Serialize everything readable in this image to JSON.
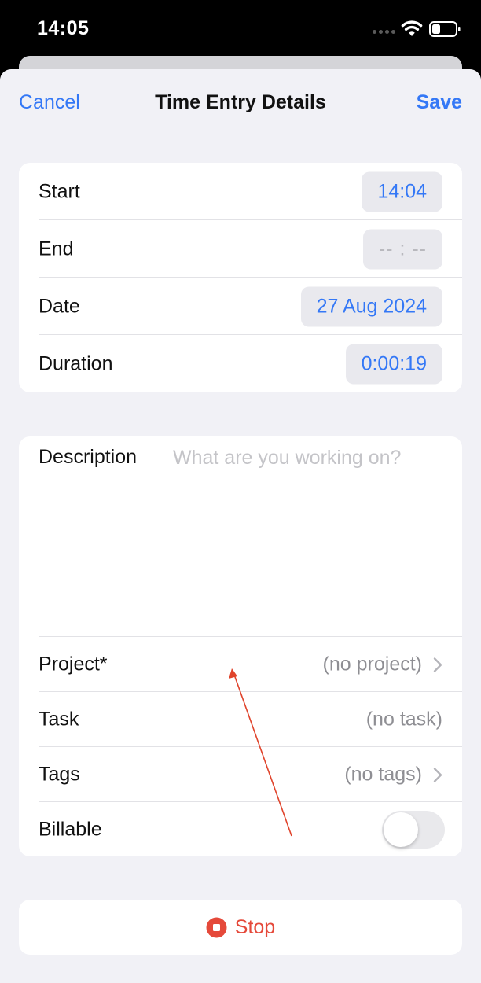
{
  "status_bar": {
    "time": "14:05",
    "icons": [
      "signal-dots-icon",
      "wifi-icon",
      "battery-icon"
    ]
  },
  "nav": {
    "cancel_label": "Cancel",
    "title": "Time Entry Details",
    "save_label": "Save"
  },
  "time_section": {
    "rows": [
      {
        "label": "Start",
        "value": "14:04"
      },
      {
        "label": "End",
        "value": "-- : --"
      },
      {
        "label": "Date",
        "value": "27 Aug 2024"
      },
      {
        "label": "Duration",
        "value": "0:00:19"
      }
    ]
  },
  "details_section": {
    "description_label": "Description",
    "description_placeholder": "What are you working on?",
    "description_value": "",
    "project": {
      "label": "Project*",
      "value": "(no project)"
    },
    "task": {
      "label": "Task",
      "value": "(no task)"
    },
    "tags": {
      "label": "Tags",
      "value": "(no tags)"
    },
    "billable": {
      "label": "Billable",
      "on": false
    }
  },
  "stop_button": {
    "label": "Stop",
    "icon": "stop-circle-icon"
  },
  "colors": {
    "accent": "#3478f6",
    "destructive": "#e5493a",
    "background": "#f1f1f6",
    "secondary_text": "#8e8e93",
    "annotation_arrow": "#e0442c"
  }
}
